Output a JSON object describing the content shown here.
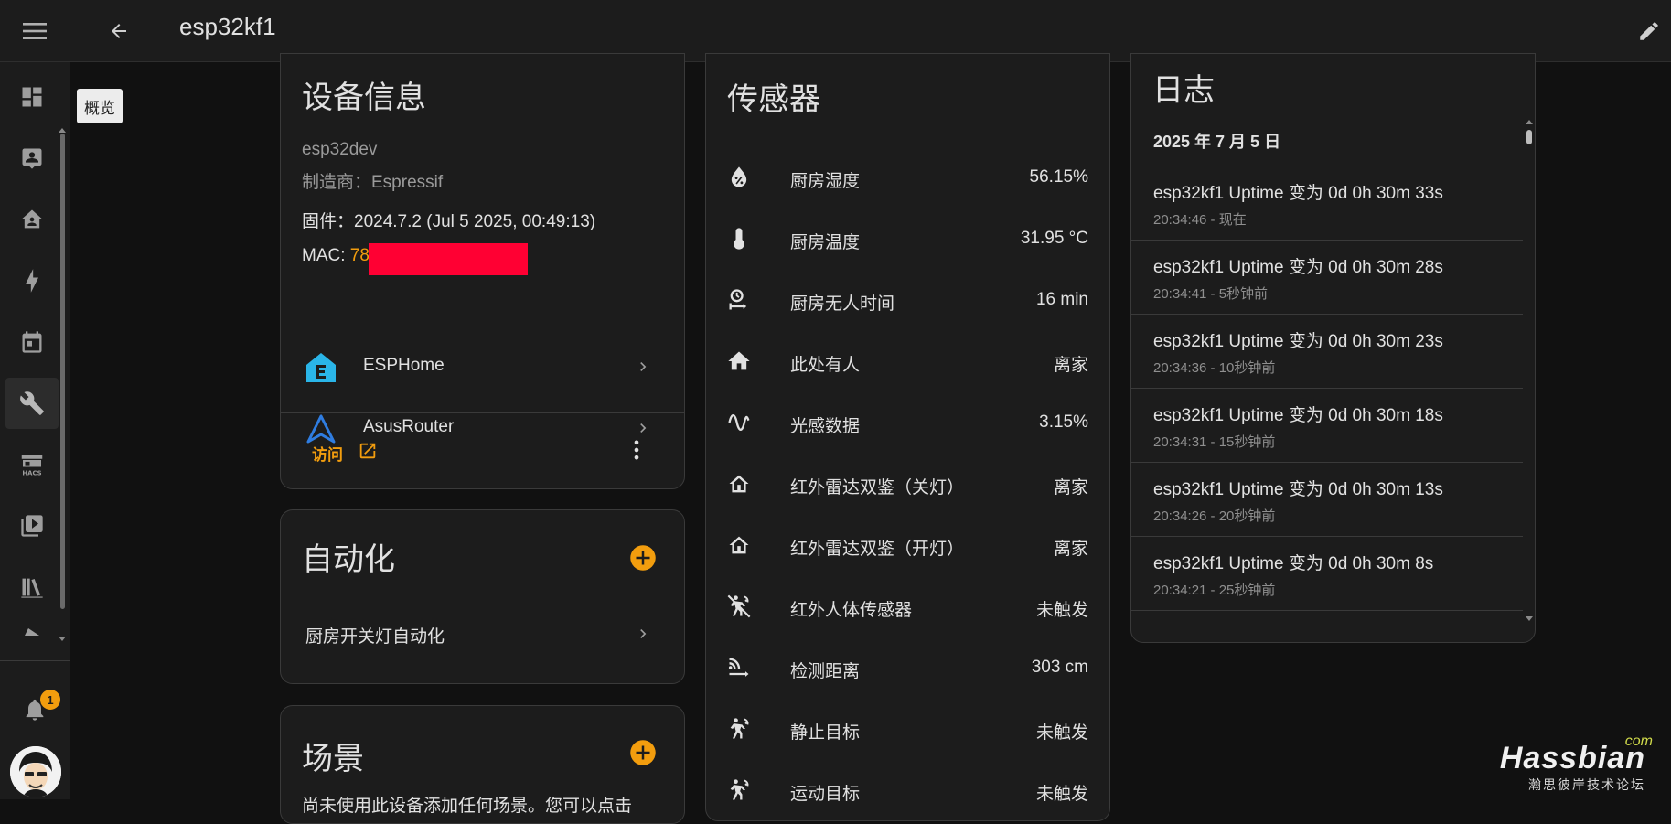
{
  "header": {
    "title": "esp32kf1"
  },
  "tooltip": "概览",
  "notifications": {
    "count": "1"
  },
  "device_info": {
    "title": "设备信息",
    "model": "esp32dev",
    "manufacturer": "制造商：Espressif",
    "firmware": "固件：2024.7.2 (Jul 5 2025, 00:49:13)",
    "mac_label": "MAC: ",
    "mac_value": "78",
    "integrations": [
      {
        "name": "ESPHome",
        "icon": "esphome-icon"
      },
      {
        "name": "AsusRouter",
        "icon": "asusrouter-icon"
      }
    ],
    "visit_label": "访问"
  },
  "automation": {
    "title": "自动化",
    "items": [
      "厨房开关灯自动化"
    ]
  },
  "scenes": {
    "title": "场景",
    "description": "尚未使用此设备添加任何场景。您可以点击"
  },
  "sensors": {
    "title": "传感器",
    "rows": [
      {
        "name": "厨房湿度",
        "value": "56.15%",
        "icon": "water-percent-icon"
      },
      {
        "name": "厨房温度",
        "value": "31.95 °C",
        "icon": "thermometer-icon"
      },
      {
        "name": "厨房无人时间",
        "value": "16 min",
        "icon": "timer-person-icon"
      },
      {
        "name": "此处有人",
        "value": "离家",
        "icon": "home-filled-icon"
      },
      {
        "name": "光感数据",
        "value": "3.15%",
        "icon": "sine-wave-icon"
      },
      {
        "name": "红外雷达双鉴（关灯）",
        "value": "离家",
        "icon": "home-outline-icon"
      },
      {
        "name": "红外雷达双鉴（开灯）",
        "value": "离家",
        "icon": "home-outline-icon"
      },
      {
        "name": "红外人体传感器",
        "value": "未触发",
        "icon": "motion-sensor-off-icon"
      },
      {
        "name": "检测距离",
        "value": "303 cm",
        "icon": "signal-distance-icon"
      },
      {
        "name": "静止目标",
        "value": "未触发",
        "icon": "motion-sensor-icon"
      },
      {
        "name": "运动目标",
        "value": "未触发",
        "icon": "motion-sensor-icon"
      }
    ]
  },
  "logbook": {
    "title": "日志",
    "date": "2025 年 7 月 5 日",
    "entries": [
      {
        "message": "esp32kf1 Uptime 变为 0d 0h 30m 33s",
        "time": "20:34:46 - 现在"
      },
      {
        "message": "esp32kf1 Uptime 变为 0d 0h 30m 28s",
        "time": "20:34:41 - 5秒钟前"
      },
      {
        "message": "esp32kf1 Uptime 变为 0d 0h 30m 23s",
        "time": "20:34:36 - 10秒钟前"
      },
      {
        "message": "esp32kf1 Uptime 变为 0d 0h 30m 18s",
        "time": "20:34:31 - 15秒钟前"
      },
      {
        "message": "esp32kf1 Uptime 变为 0d 0h 30m 13s",
        "time": "20:34:26 - 20秒钟前"
      },
      {
        "message": "esp32kf1 Uptime 变为 0d 0h 30m 8s",
        "time": "20:34:21 - 25秒钟前"
      }
    ]
  },
  "watermark": {
    "brand": "Hassbian",
    "suffix": "com",
    "tagline": "瀚思彼岸技术论坛"
  },
  "colors": {
    "accent": "#f29d0e",
    "background": "#111111",
    "card": "#1c1c1c",
    "redaction": "#ff0033"
  }
}
